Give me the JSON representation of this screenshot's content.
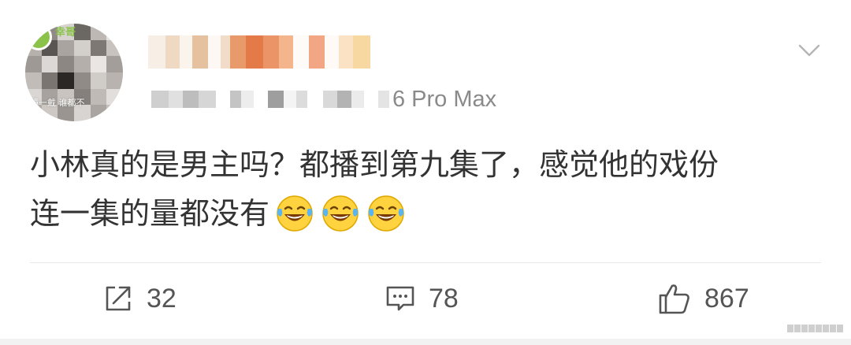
{
  "post": {
    "device": "6 Pro Max",
    "content_line1": "小林真的是男主吗？都播到第九集了，感觉他的戏份",
    "content_line2": "连一集的量都没有",
    "emojis": [
      "laugh-cry-emoji",
      "laugh-cry-emoji",
      "laugh-cry-emoji"
    ],
    "avatar_caption": "镜一戴 谁都不",
    "avatar_badge_text": "幸哥"
  },
  "actions": {
    "repost_count": "32",
    "comment_count": "78",
    "like_count": "867"
  },
  "colors": {
    "text": "#333333",
    "meta": "#8a8a8a",
    "icon": "#555555",
    "divider": "#e8e8e8",
    "accent_badge": "#8bc34a"
  }
}
